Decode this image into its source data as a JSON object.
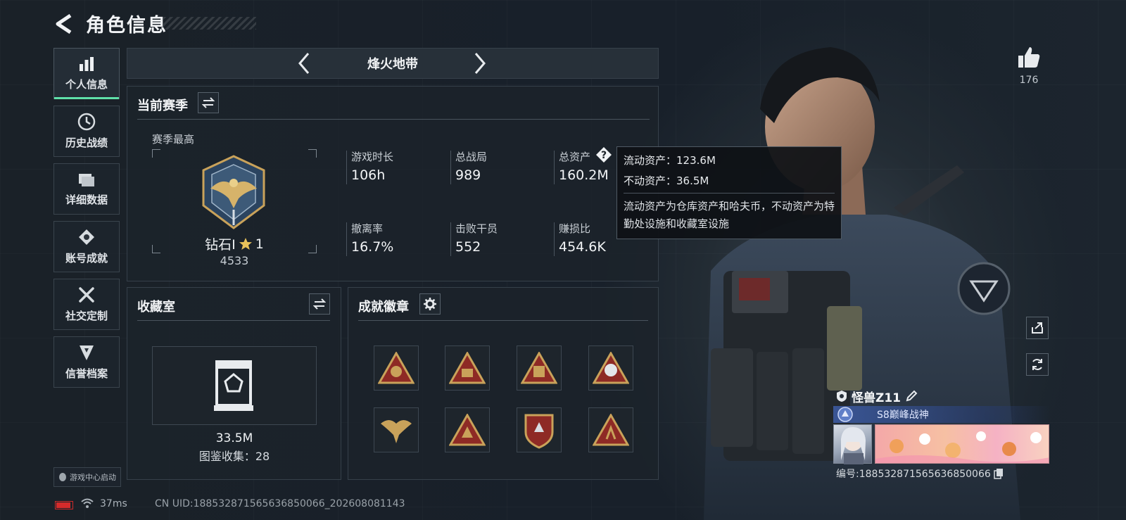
{
  "header": {
    "title": "角色信息"
  },
  "nav": [
    {
      "label": "个人信息",
      "icon": "bar-chart-icon",
      "active": true
    },
    {
      "label": "历史战绩",
      "icon": "clock-icon",
      "active": false
    },
    {
      "label": "详细数据",
      "icon": "folder-icon",
      "active": false
    },
    {
      "label": "账号成就",
      "icon": "achievement-icon",
      "active": false
    },
    {
      "label": "社交定制",
      "icon": "tools-icon",
      "active": false
    },
    {
      "label": "信誉档案",
      "icon": "shield-icon",
      "active": false
    }
  ],
  "launch_badge": "游戏中心启动",
  "status": {
    "ping": "37ms",
    "uid": "CN UID:18853287156563​6850066_202608081143"
  },
  "map": {
    "name": "烽火地带"
  },
  "season": {
    "title": "当前赛季",
    "season_high": "赛季最高",
    "rank_name": "钻石I",
    "rank_stars": "1",
    "rank_score": "4533",
    "stats": [
      {
        "label": "游戏时长",
        "value": "106h"
      },
      {
        "label": "总战局",
        "value": "989"
      },
      {
        "label": "总资产",
        "value": "160.2M"
      },
      {
        "label": "撤离率",
        "value": "16.7%"
      },
      {
        "label": "击败干员",
        "value": "552"
      },
      {
        "label": "赚损比",
        "value": "454.6K"
      }
    ]
  },
  "tooltip": {
    "liquid": "流动资产：123.6M",
    "fixed": "不动资产：36.5M",
    "desc": "流动资产为仓库资产和哈夫币，不动资产为特勤处设施和收藏室设施"
  },
  "collection": {
    "title": "收藏室",
    "value": "33.5M",
    "count": "图鉴收集：28"
  },
  "badges": {
    "title": "成就徽章"
  },
  "likes": {
    "count": "176"
  },
  "player": {
    "name": "怪兽Z11",
    "title": "S8巅峰战神",
    "id": "编号:18853287156563​6850066"
  },
  "colors": {
    "accent": "#5fe0a9",
    "panel": "#1c232b",
    "medal_gold": "#c9a25a",
    "medal_red": "#8e2a25"
  }
}
